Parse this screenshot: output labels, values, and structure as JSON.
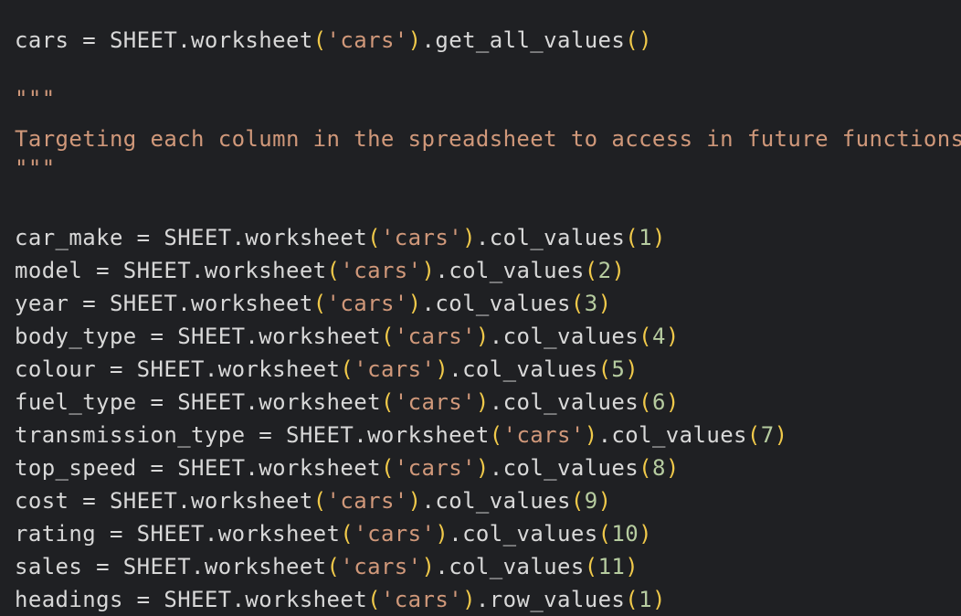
{
  "editor": {
    "colors": {
      "background": "#1f2023",
      "plain": "#d8d8d8",
      "string": "#d0987a",
      "paren": "#f0c94a",
      "number": "#b6cca0",
      "docstring": "#d0987a"
    },
    "lines": [
      [
        {
          "t": "cars = SHEET.worksheet",
          "k": "plain"
        },
        {
          "t": "(",
          "k": "paren"
        },
        {
          "t": "'cars'",
          "k": "str"
        },
        {
          "t": ")",
          "k": "paren"
        },
        {
          "t": ".get_all_values",
          "k": "plain"
        },
        {
          "t": "()",
          "k": "paren"
        }
      ],
      [],
      [
        {
          "t": "\"\"\"",
          "k": "doc"
        }
      ],
      [
        {
          "t": "Targeting each column in the spreadsheet to access in future functions.",
          "k": "doc"
        }
      ],
      [
        {
          "t": "\"\"\"",
          "k": "doc"
        }
      ],
      [],
      [],
      [
        {
          "t": "car_make = SHEET.worksheet",
          "k": "plain"
        },
        {
          "t": "(",
          "k": "paren"
        },
        {
          "t": "'cars'",
          "k": "str"
        },
        {
          "t": ")",
          "k": "paren"
        },
        {
          "t": ".col_values",
          "k": "plain"
        },
        {
          "t": "(",
          "k": "paren"
        },
        {
          "t": "1",
          "k": "num"
        },
        {
          "t": ")",
          "k": "paren"
        }
      ],
      [
        {
          "t": "model = SHEET.worksheet",
          "k": "plain"
        },
        {
          "t": "(",
          "k": "paren"
        },
        {
          "t": "'cars'",
          "k": "str"
        },
        {
          "t": ")",
          "k": "paren"
        },
        {
          "t": ".col_values",
          "k": "plain"
        },
        {
          "t": "(",
          "k": "paren"
        },
        {
          "t": "2",
          "k": "num"
        },
        {
          "t": ")",
          "k": "paren"
        }
      ],
      [
        {
          "t": "year = SHEET.worksheet",
          "k": "plain"
        },
        {
          "t": "(",
          "k": "paren"
        },
        {
          "t": "'cars'",
          "k": "str"
        },
        {
          "t": ")",
          "k": "paren"
        },
        {
          "t": ".col_values",
          "k": "plain"
        },
        {
          "t": "(",
          "k": "paren"
        },
        {
          "t": "3",
          "k": "num"
        },
        {
          "t": ")",
          "k": "paren"
        }
      ],
      [
        {
          "t": "body_type = SHEET.worksheet",
          "k": "plain"
        },
        {
          "t": "(",
          "k": "paren"
        },
        {
          "t": "'cars'",
          "k": "str"
        },
        {
          "t": ")",
          "k": "paren"
        },
        {
          "t": ".col_values",
          "k": "plain"
        },
        {
          "t": "(",
          "k": "paren"
        },
        {
          "t": "4",
          "k": "num"
        },
        {
          "t": ")",
          "k": "paren"
        }
      ],
      [
        {
          "t": "colour = SHEET.worksheet",
          "k": "plain"
        },
        {
          "t": "(",
          "k": "paren"
        },
        {
          "t": "'cars'",
          "k": "str"
        },
        {
          "t": ")",
          "k": "paren"
        },
        {
          "t": ".col_values",
          "k": "plain"
        },
        {
          "t": "(",
          "k": "paren"
        },
        {
          "t": "5",
          "k": "num"
        },
        {
          "t": ")",
          "k": "paren"
        }
      ],
      [
        {
          "t": "fuel_type = SHEET.worksheet",
          "k": "plain"
        },
        {
          "t": "(",
          "k": "paren"
        },
        {
          "t": "'cars'",
          "k": "str"
        },
        {
          "t": ")",
          "k": "paren"
        },
        {
          "t": ".col_values",
          "k": "plain"
        },
        {
          "t": "(",
          "k": "paren"
        },
        {
          "t": "6",
          "k": "num"
        },
        {
          "t": ")",
          "k": "paren"
        }
      ],
      [
        {
          "t": "transmission_type = SHEET.worksheet",
          "k": "plain"
        },
        {
          "t": "(",
          "k": "paren"
        },
        {
          "t": "'cars'",
          "k": "str"
        },
        {
          "t": ")",
          "k": "paren"
        },
        {
          "t": ".col_values",
          "k": "plain"
        },
        {
          "t": "(",
          "k": "paren"
        },
        {
          "t": "7",
          "k": "num"
        },
        {
          "t": ")",
          "k": "paren"
        }
      ],
      [
        {
          "t": "top_speed = SHEET.worksheet",
          "k": "plain"
        },
        {
          "t": "(",
          "k": "paren"
        },
        {
          "t": "'cars'",
          "k": "str"
        },
        {
          "t": ")",
          "k": "paren"
        },
        {
          "t": ".col_values",
          "k": "plain"
        },
        {
          "t": "(",
          "k": "paren"
        },
        {
          "t": "8",
          "k": "num"
        },
        {
          "t": ")",
          "k": "paren"
        }
      ],
      [
        {
          "t": "cost = SHEET.worksheet",
          "k": "plain"
        },
        {
          "t": "(",
          "k": "paren"
        },
        {
          "t": "'cars'",
          "k": "str"
        },
        {
          "t": ")",
          "k": "paren"
        },
        {
          "t": ".col_values",
          "k": "plain"
        },
        {
          "t": "(",
          "k": "paren"
        },
        {
          "t": "9",
          "k": "num"
        },
        {
          "t": ")",
          "k": "paren"
        }
      ],
      [
        {
          "t": "rating = SHEET.worksheet",
          "k": "plain"
        },
        {
          "t": "(",
          "k": "paren"
        },
        {
          "t": "'cars'",
          "k": "str"
        },
        {
          "t": ")",
          "k": "paren"
        },
        {
          "t": ".col_values",
          "k": "plain"
        },
        {
          "t": "(",
          "k": "paren"
        },
        {
          "t": "10",
          "k": "num"
        },
        {
          "t": ")",
          "k": "paren"
        }
      ],
      [
        {
          "t": "sales = SHEET.worksheet",
          "k": "plain"
        },
        {
          "t": "(",
          "k": "paren"
        },
        {
          "t": "'cars'",
          "k": "str"
        },
        {
          "t": ")",
          "k": "paren"
        },
        {
          "t": ".col_values",
          "k": "plain"
        },
        {
          "t": "(",
          "k": "paren"
        },
        {
          "t": "11",
          "k": "num"
        },
        {
          "t": ")",
          "k": "paren"
        }
      ],
      [
        {
          "t": "headings = SHEET.worksheet",
          "k": "plain"
        },
        {
          "t": "(",
          "k": "paren"
        },
        {
          "t": "'cars'",
          "k": "str"
        },
        {
          "t": ")",
          "k": "paren"
        },
        {
          "t": ".row_values",
          "k": "plain"
        },
        {
          "t": "(",
          "k": "paren"
        },
        {
          "t": "1",
          "k": "num"
        },
        {
          "t": ")",
          "k": "paren"
        }
      ]
    ]
  }
}
